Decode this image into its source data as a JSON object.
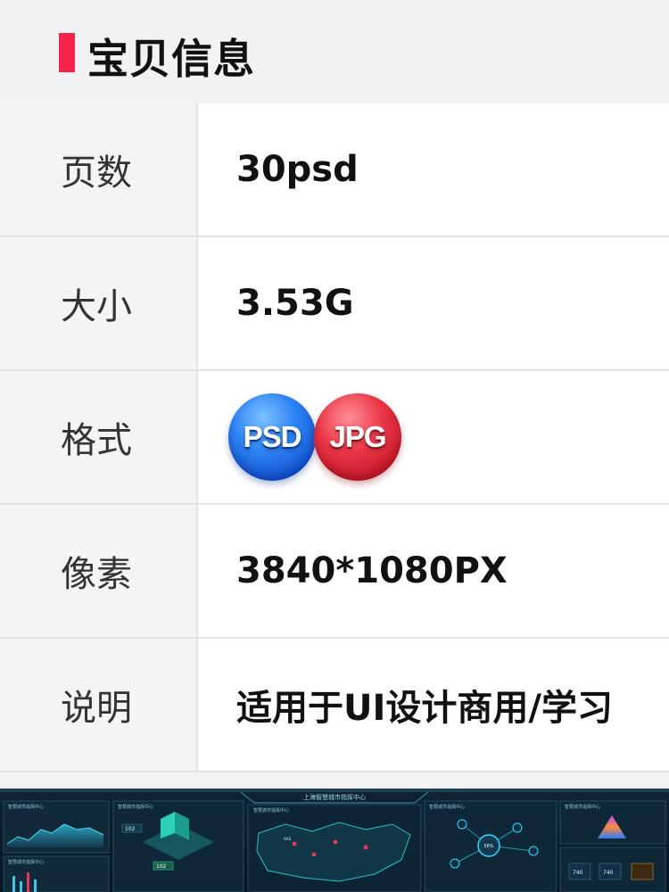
{
  "header": {
    "title": "宝贝信息"
  },
  "rows": [
    {
      "label": "页数",
      "value": "30psd"
    },
    {
      "label": "大小",
      "value": "3.53G"
    },
    {
      "label": "格式",
      "badges": [
        "PSD",
        "JPG"
      ]
    },
    {
      "label": "像素",
      "value": "3840*1080PX"
    },
    {
      "label": "说明",
      "value": "适用于UI设计商用/学习"
    }
  ],
  "preview": {
    "banner_title": "上海智慧城市指挥中心",
    "panel_titles": [
      "智慧城市指挥中心",
      "智慧城市指挥中心",
      "智慧城市指挥中心",
      "智慧城市指挥中心",
      "智慧城市指挥中心",
      "智慧城市指挥中心"
    ],
    "metric_a": "102",
    "metric_b": "102",
    "ring_value": "56%",
    "map_label": "AAS",
    "mini_values": [
      "740",
      "740"
    ]
  },
  "colors": {
    "accent_bar": "#f6244a",
    "psd_badge": "#2f86f5",
    "jpg_badge": "#ec3848",
    "preview_bg": "#0b1c2a",
    "preview_glow": "#27d3d8"
  }
}
